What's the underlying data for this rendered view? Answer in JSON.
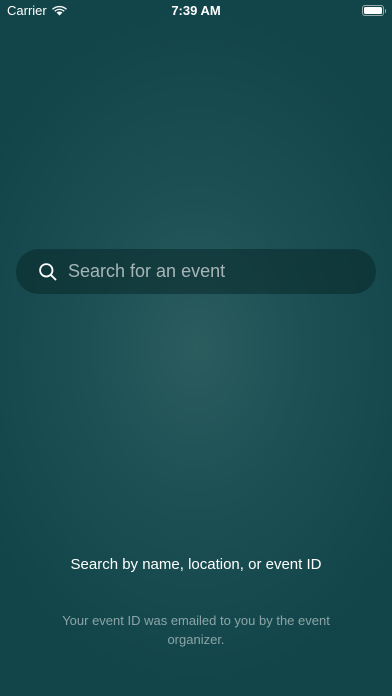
{
  "status_bar": {
    "carrier": "Carrier",
    "time": "7:39 AM",
    "wifi_icon": "wifi-icon",
    "battery_icon": "battery-icon"
  },
  "search": {
    "placeholder": "Search for an event",
    "value": "",
    "icon": "search-icon"
  },
  "hint": {
    "title": "Search by name, location, or event ID",
    "subtitle": "Your event ID was emailed to you by the event organizer."
  },
  "colors": {
    "background": "#1c5054",
    "background_center": "#2b5d5f",
    "search_bar": "#0f3336"
  }
}
